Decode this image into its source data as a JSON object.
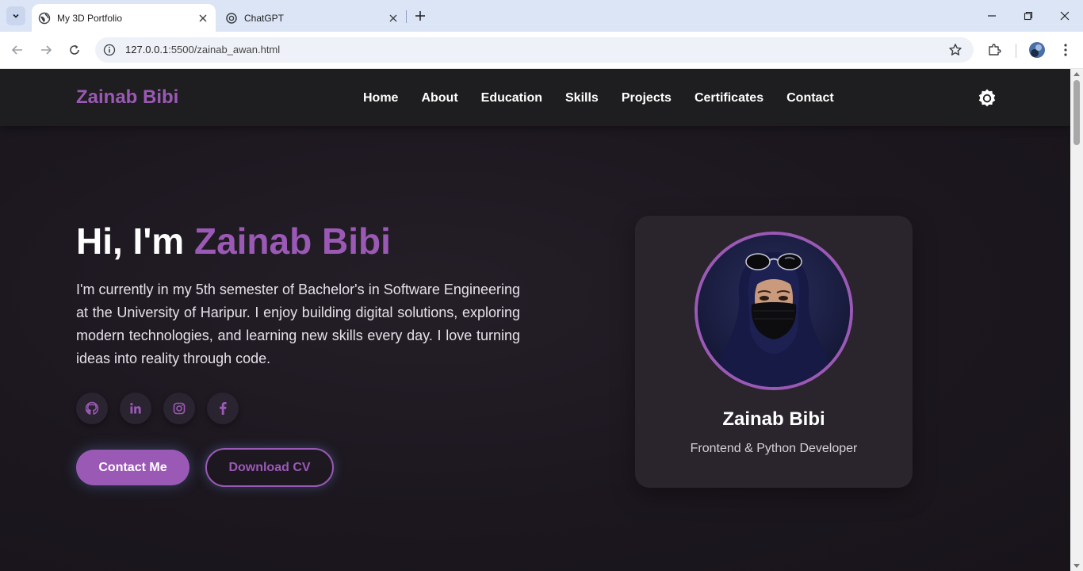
{
  "browser": {
    "tabs": [
      {
        "title": "My 3D Portfolio",
        "active": true,
        "icon": "globe-icon"
      },
      {
        "title": "ChatGPT",
        "active": false,
        "icon": "chatgpt-icon"
      }
    ],
    "url_host": "127.0.0.1",
    "url_rest": ":5500/zainab_awan.html"
  },
  "site": {
    "logo": "Zainab Bibi",
    "nav": [
      "Home",
      "About",
      "Education",
      "Skills",
      "Projects",
      "Certificates",
      "Contact"
    ],
    "hero": {
      "greeting": "Hi, I'm ",
      "name": "Zainab Bibi",
      "description": "I'm currently in my 5th semester of Bachelor's in Software Engineering at the University of Haripur. I enjoy building digital solutions, exploring modern technologies, and learning new skills every day. I love turning ideas into reality through code.",
      "socials": [
        "github-icon",
        "linkedin-icon",
        "instagram-icon",
        "facebook-icon"
      ],
      "primary_button": "Contact Me",
      "secondary_button": "Download CV"
    },
    "card": {
      "name": "Zainab Bibi",
      "role": "Frontend & Python Developer"
    }
  },
  "colors": {
    "accent": "#9b59b6",
    "background": "#1c171f",
    "header": "#1e1d1f",
    "card": "#2a242d"
  }
}
